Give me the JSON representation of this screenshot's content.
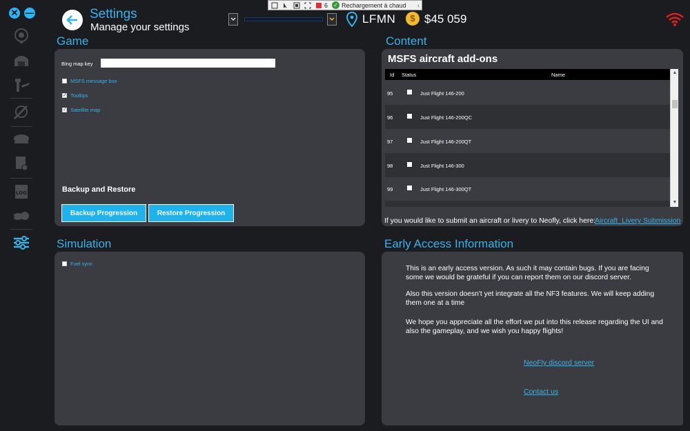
{
  "header": {
    "title": "Settings",
    "subtitle": "Manage your settings",
    "location": "LFMN",
    "money": "$45 059"
  },
  "hot_reload_toolbar": {
    "count": "6",
    "status": "Rechargement à chaud"
  },
  "game": {
    "section_title": "Game",
    "bing_label": "Bing map key",
    "bing_value": "",
    "checkboxes": [
      {
        "label": "MSFS message box",
        "checked": false
      },
      {
        "label": "Tooltips",
        "checked": true
      },
      {
        "label": "Satellite map",
        "checked": true
      }
    ],
    "backup_title": "Backup and Restore",
    "backup_button": "Backup Progression",
    "restore_button": "Restore Progression"
  },
  "simulation": {
    "section_title": "Simulation",
    "checkboxes": [
      {
        "label": "Fuel sync",
        "checked": false
      }
    ]
  },
  "content": {
    "section_title": "Content",
    "panel_title": "MSFS aircraft add-ons",
    "columns": [
      "Id",
      "Status",
      "Name"
    ],
    "rows": [
      {
        "id": "95",
        "checked": false,
        "name": "Just Flight 146-200"
      },
      {
        "id": "96",
        "checked": false,
        "name": "Just Flight 146-200QC"
      },
      {
        "id": "97",
        "checked": false,
        "name": "Just Flight 146-200QT"
      },
      {
        "id": "98",
        "checked": false,
        "name": "Just Flight 146-300"
      },
      {
        "id": "99",
        "checked": false,
        "name": "Just Flight 146-300QT"
      }
    ],
    "submit_text": "If you would like to submit an aircraft or livery to Neofly, click here:",
    "submit_link": "Aircraft_Livery Submission"
  },
  "early_access": {
    "section_title": "Early Access Information",
    "paragraphs": [
      "This is an early access version. As such it may contain bugs. If you are facing some we would be grateful if you can report them on our discord server.",
      "Also this version doesn't yet integrate all the NF3 features. We will keep adding them one at a time",
      "We hope you appreciate all the effort we put into this release regarding the UI and also the gameplay, and we wish you happy flights!"
    ],
    "discord_link": "NeoFly discord server",
    "contact_link": "Contact us"
  },
  "colors": {
    "accent": "#35b4ec",
    "button": "#1fb3ee",
    "panel": "#3a3c41",
    "background": "#1b1c1f",
    "coin": "#f5b82e",
    "wifi": "#e02020"
  },
  "icons": {
    "sidebar": [
      "trophy-icon",
      "hangar-icon",
      "tower-icon",
      "globe-plane-icon",
      "pilot-cap-icon",
      "certificate-icon",
      "logbook-icon",
      "coins-icon",
      "settings-sliders-icon"
    ]
  }
}
